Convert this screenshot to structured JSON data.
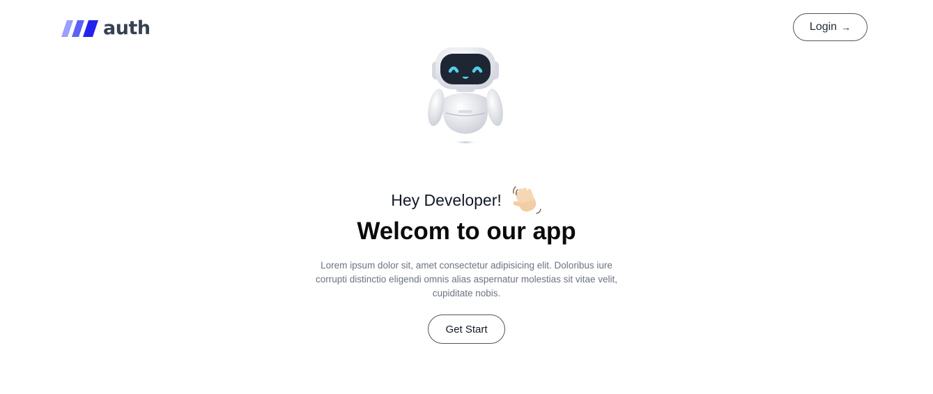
{
  "header": {
    "logo_text": "auth",
    "login_label": "Login",
    "login_icon": "arrow-right-icon"
  },
  "hero": {
    "mascot_icon": "robot-icon",
    "greeting": "Hey Developer!",
    "greeting_icon": "waving-hand-icon",
    "headline": "Welcom to our app",
    "description": "Lorem ipsum dolor sit, amet consectetur adipisicing elit. Doloribus iure corrupti distinctio eligendi omnis alias aspernatur molestias sit vitae velit, cupiditate nobis.",
    "cta_label": "Get Start"
  },
  "colors": {
    "brand_gradient_start": "#8b93ff",
    "brand_gradient_end": "#2b2bf0",
    "logo_text": "#374151",
    "button_border": "#4b5563",
    "body_text": "#6b7280",
    "robot_visor": "#1f2937",
    "robot_eyes": "#4fd1e8"
  }
}
